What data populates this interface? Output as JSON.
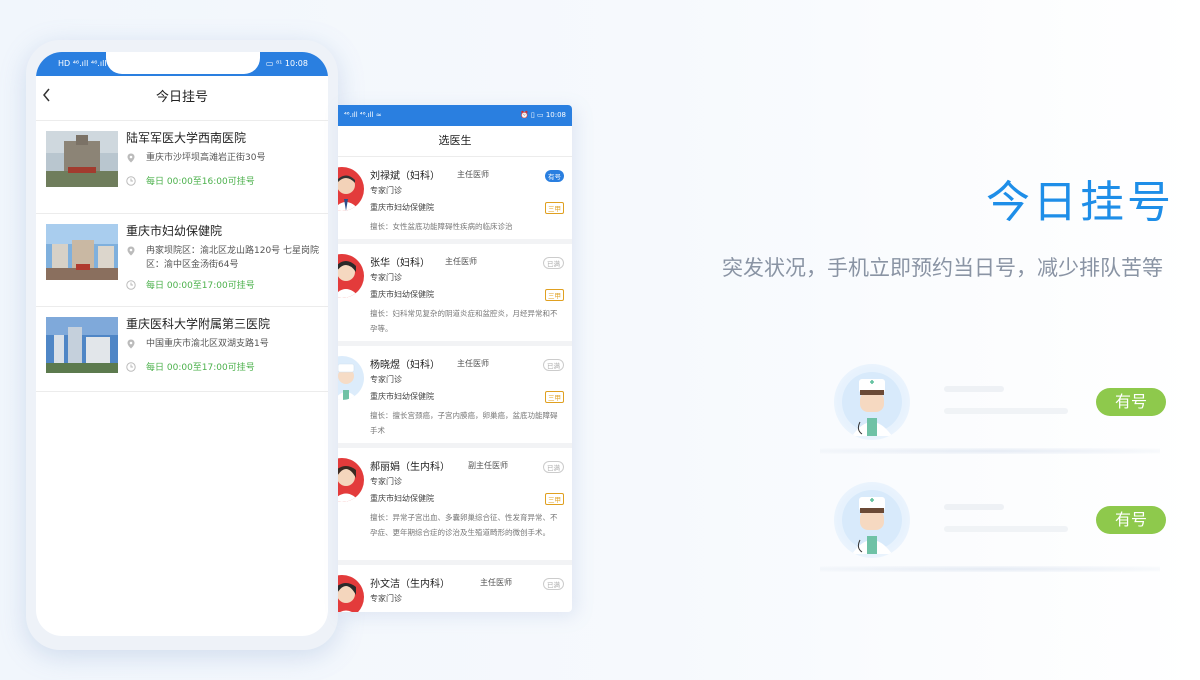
{
  "phone1": {
    "status_time": "10:08",
    "status_left": "HD ⁴⁶.ıll ⁴⁶.ıll",
    "status_right": "▭ ⁸¹ 10:08",
    "title": "今日挂号",
    "hospitals": [
      {
        "name": "陆军军医大学西南医院",
        "address": "重庆市沙坪坝高滩岩正街30号",
        "hours": "每日 00:00至16:00可挂号"
      },
      {
        "name": "重庆市妇幼保健院",
        "address": "冉家坝院区：渝北区龙山路120号 七星岗院区：渝中区金汤街64号",
        "hours": "每日 00:00至17:00可挂号"
      },
      {
        "name": "重庆医科大学附属第三医院",
        "address": "中国重庆市渝北区双湖支路1号",
        "hours": "每日 00:00至17:00可挂号"
      }
    ]
  },
  "phone2": {
    "status_left": "⁴⁶.ıll ⁴⁶.ıll ≈",
    "status_right": "⏰ ▯ ▭ 10:08",
    "title": "选医生",
    "doctors": [
      {
        "name": "刘禄斌（妇科）",
        "title": "主任医师",
        "badge": "有号",
        "badge_type": "available",
        "clinic": "专家门诊",
        "hospital": "重庆市妇幼保健院",
        "grade": "三甲",
        "specialty": "擅长：女性盆底功能障碍性疾病的临床诊治"
      },
      {
        "name": "张华（妇科）",
        "title": "主任医师",
        "badge": "已满",
        "badge_type": "full",
        "clinic": "专家门诊",
        "hospital": "重庆市妇幼保健院",
        "grade": "三甲",
        "specialty": "擅长：妇科常见复杂的阴道炎症和盆腔炎，月经异常和不孕等。"
      },
      {
        "name": "杨晓煜（妇科）",
        "title": "主任医师",
        "badge": "已满",
        "badge_type": "full",
        "clinic": "专家门诊",
        "hospital": "重庆市妇幼保健院",
        "grade": "三甲",
        "specialty": "擅长：擅长宫颈癌，子宫内膜癌，卵巢癌，盆底功能障碍手术"
      },
      {
        "name": "郝丽娟（生内科）",
        "title": "副主任医师",
        "badge": "已满",
        "badge_type": "full",
        "clinic": "专家门诊",
        "hospital": "重庆市妇幼保健院",
        "grade": "三甲",
        "specialty": "擅长：异常子宫出血、多囊卵巢综合征、性发育异常、不孕症、更年期综合症的诊治及生殖道畸形的微创手术。"
      },
      {
        "name": "孙文洁（生内科）",
        "title": "主任医师",
        "badge": "已满",
        "badge_type": "full",
        "clinic": "专家门诊"
      }
    ]
  },
  "hero": {
    "title": "今日挂号",
    "subtitle": "突发状况，手机立即预约当日号，减少排队苦等",
    "cards": [
      {
        "pill": "有号"
      },
      {
        "pill": "有号"
      }
    ]
  },
  "colors": {
    "brand_blue": "#2a7fe0",
    "hero_blue": "#1e8ee8",
    "green_hours": "#4cb14c",
    "pill_green": "#8ec94c",
    "grade_gold": "#e0a020"
  }
}
